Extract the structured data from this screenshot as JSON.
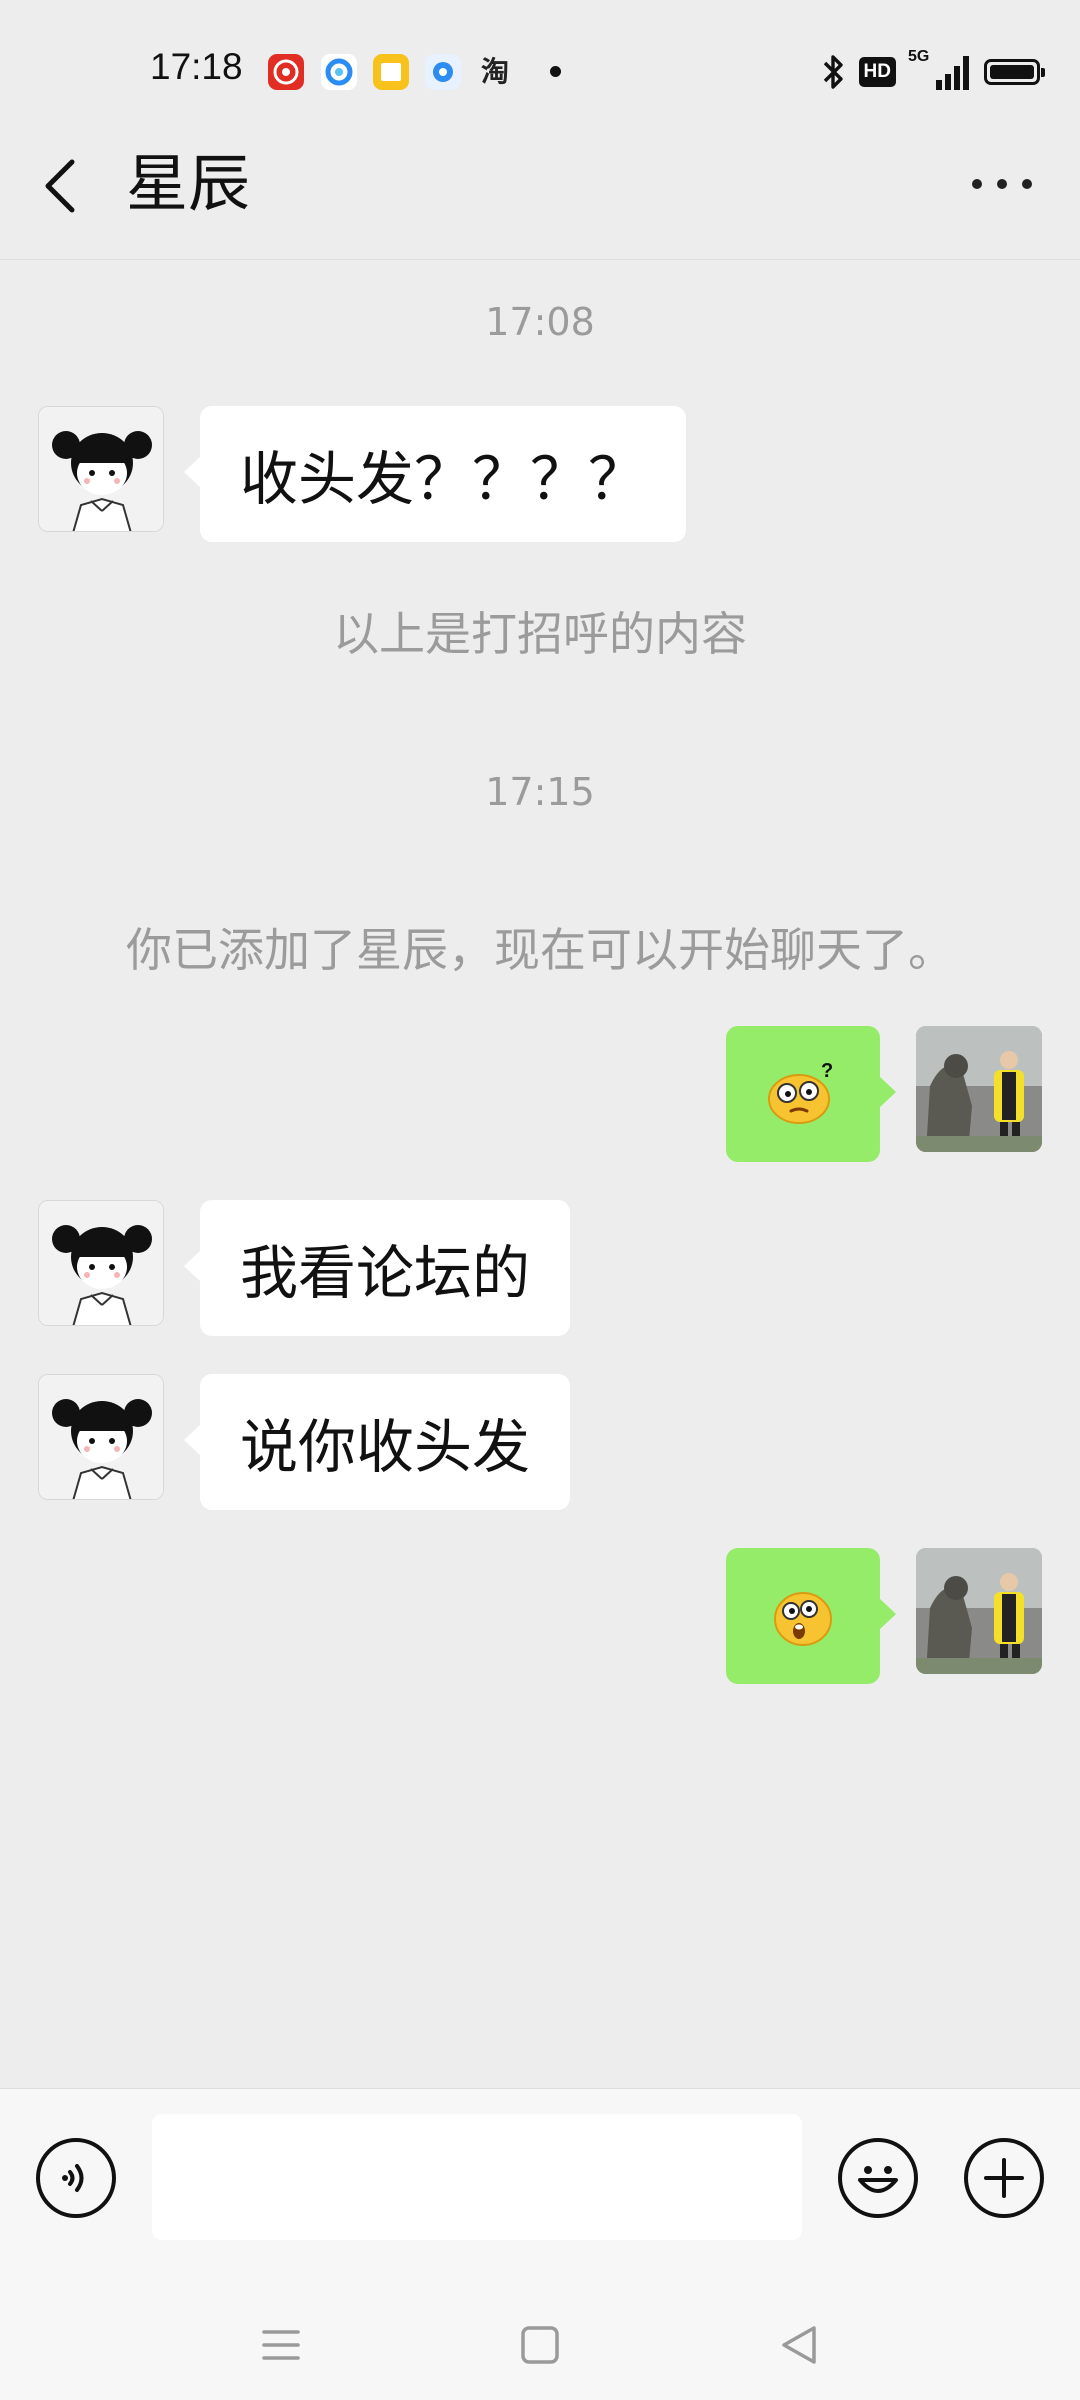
{
  "status_bar": {
    "time": "17:18",
    "app_icons": [
      "pinduoduo-icon",
      "browser-icon",
      "notes-icon",
      "app-icon",
      "taobao-icon"
    ],
    "taobao_label": "淘",
    "hd_label": "HD",
    "network_label": "5G"
  },
  "header": {
    "title": "星辰"
  },
  "messages": [
    {
      "type": "time",
      "text": "17:08"
    },
    {
      "type": "incoming",
      "text": "收头发？？？？"
    },
    {
      "type": "system",
      "text": "以上是打招呼的内容"
    },
    {
      "type": "time",
      "text": "17:15"
    },
    {
      "type": "system",
      "text": "你已添加了星辰，现在可以开始聊天了。"
    },
    {
      "type": "outgoing",
      "emoji": "confused-emoji"
    },
    {
      "type": "incoming",
      "text": "我看论坛的"
    },
    {
      "type": "incoming",
      "text": "说你收头发"
    },
    {
      "type": "outgoing",
      "emoji": "surprised-emoji"
    }
  ],
  "input_bar": {
    "voice_icon": "voice-icon",
    "message_value": "",
    "emoji_icon": "emoji-icon",
    "plus_icon": "plus-icon"
  },
  "nav_bar": [
    "menu-icon",
    "home-icon",
    "back-triangle-icon"
  ],
  "colors": {
    "background": "#ededed",
    "incoming_bubble": "#ffffff",
    "outgoing_bubble": "#95ec69",
    "muted_text": "#9b9b9b"
  }
}
